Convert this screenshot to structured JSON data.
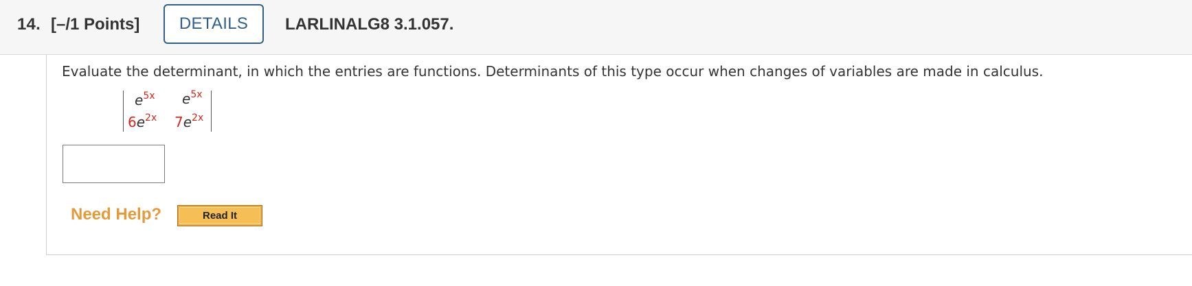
{
  "header": {
    "number": "14.",
    "points": "[–/1 Points]",
    "details_label": "DETAILS",
    "code": "LARLINALG8 3.1.057."
  },
  "question": {
    "prompt": "Evaluate the determinant, in which the entries are functions. Determinants of this type occur when changes of variables are made in calculus.",
    "matrix": {
      "r1c1": {
        "coef": "",
        "base": "e",
        "exp": "5x"
      },
      "r1c2": {
        "coef": "",
        "base": "e",
        "exp": "5x"
      },
      "r2c1": {
        "coef": "6",
        "base": "e",
        "exp": "2x"
      },
      "r2c2": {
        "coef": "7",
        "base": "e",
        "exp": "2x"
      }
    },
    "answer_value": ""
  },
  "help": {
    "label": "Need Help?",
    "read_it_label": "Read It"
  },
  "colors": {
    "accent_blue": "#2f5f8a",
    "help_orange": "#e59a3a",
    "highlight_red": "#d8261c"
  }
}
